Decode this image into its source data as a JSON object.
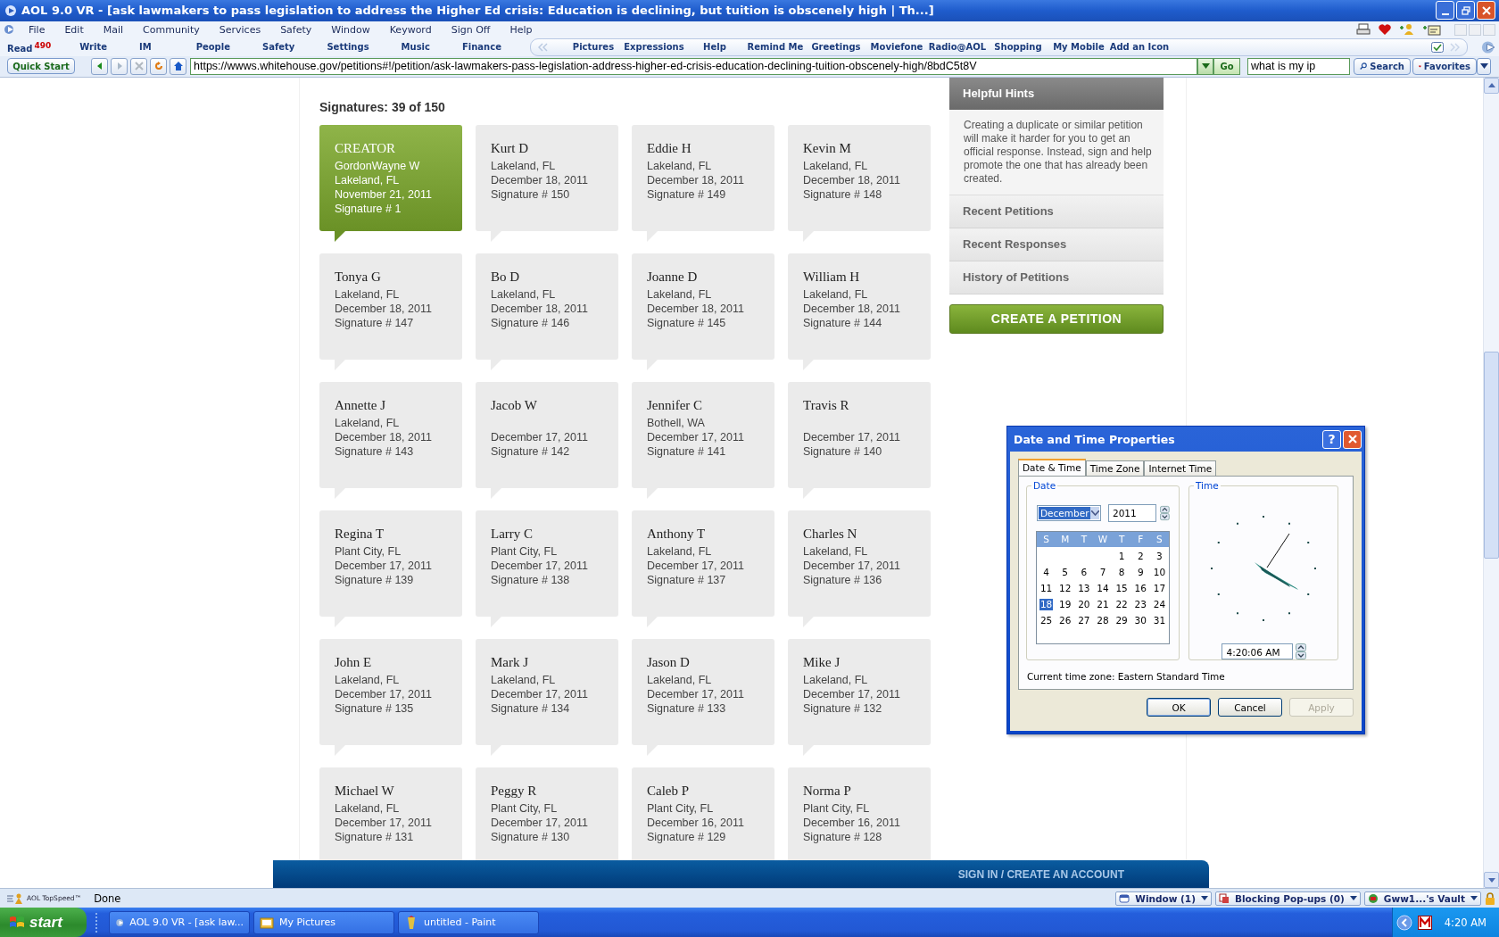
{
  "window": {
    "title": "AOL 9.0 VR - [ask lawmakers to pass legislation to address the Higher Ed crisis: Education is declining, but tuition is obscenely high | Th...]"
  },
  "menu": [
    "File",
    "Edit",
    "Mail",
    "Community",
    "Services",
    "Safety",
    "Window",
    "Keyword",
    "Sign Off",
    "Help"
  ],
  "toolbar": {
    "read": {
      "label": "Read",
      "badge": "490"
    },
    "items": [
      "Write",
      "IM",
      "People",
      "Safety",
      "Settings",
      "Music",
      "Finance"
    ],
    "favorites_strip": [
      "Pictures",
      "Expressions",
      "Help",
      "Remind Me",
      "Greetings",
      "Moviefone",
      "Radio@AOL",
      "Shopping",
      "My Mobile",
      "Add an Icon"
    ]
  },
  "address_bar": {
    "quick_start": "Quick Start",
    "url": "https://wwws.whitehouse.gov/petitions#!/petition/ask-lawmakers-pass-legislation-address-higher-ed-crisis-education-declining-tuition-obscenely-high/8bdC5t8V",
    "go": "Go",
    "search_value": "what is my ip",
    "search": "Search",
    "favorites": "Favorites"
  },
  "page": {
    "signatures_heading": "Signatures: 39 of 150",
    "cards": [
      {
        "kind": "creator",
        "label": "CREATOR",
        "name": "GordonWayne W",
        "location": "Lakeland, FL",
        "date": "November 21, 2011",
        "signature": "Signature # 1"
      },
      {
        "kind": "signer",
        "name": "Kurt D",
        "location": "Lakeland, FL",
        "date": "December 18, 2011",
        "signature": "Signature # 150"
      },
      {
        "kind": "signer",
        "name": "Eddie H",
        "location": "Lakeland, FL",
        "date": "December 18, 2011",
        "signature": "Signature # 149"
      },
      {
        "kind": "signer",
        "name": "Kevin M",
        "location": "Lakeland, FL",
        "date": "December 18, 2011",
        "signature": "Signature # 148"
      },
      {
        "kind": "signer",
        "name": "Tonya G",
        "location": "Lakeland, FL",
        "date": "December 18, 2011",
        "signature": "Signature # 147"
      },
      {
        "kind": "signer",
        "name": "Bo D",
        "location": "Lakeland, FL",
        "date": "December 18, 2011",
        "signature": "Signature # 146"
      },
      {
        "kind": "signer",
        "name": "Joanne D",
        "location": "Lakeland, FL",
        "date": "December 18, 2011",
        "signature": "Signature # 145"
      },
      {
        "kind": "signer",
        "name": "William H",
        "location": "Lakeland, FL",
        "date": "December 18, 2011",
        "signature": "Signature # 144"
      },
      {
        "kind": "signer",
        "name": "Annette J",
        "location": "Lakeland, FL",
        "date": "December 18, 2011",
        "signature": "Signature # 143"
      },
      {
        "kind": "signer",
        "name": "Jacob W",
        "date": "December 17, 2011",
        "signature": "Signature # 142"
      },
      {
        "kind": "signer",
        "name": "Jennifer C",
        "location": "Bothell, WA",
        "date": "December 17, 2011",
        "signature": "Signature # 141"
      },
      {
        "kind": "signer",
        "name": "Travis R",
        "date": "December 17, 2011",
        "signature": "Signature # 140"
      },
      {
        "kind": "signer",
        "name": "Regina T",
        "location": "Plant City, FL",
        "date": "December 17, 2011",
        "signature": "Signature # 139"
      },
      {
        "kind": "signer",
        "name": "Larry C",
        "location": "Plant City, FL",
        "date": "December 17, 2011",
        "signature": "Signature # 138"
      },
      {
        "kind": "signer",
        "name": "Anthony T",
        "location": "Lakeland, FL",
        "date": "December 17, 2011",
        "signature": "Signature # 137"
      },
      {
        "kind": "signer",
        "name": "Charles N",
        "location": "Lakeland, FL",
        "date": "December 17, 2011",
        "signature": "Signature # 136"
      },
      {
        "kind": "signer",
        "name": "John E",
        "location": "Lakeland, FL",
        "date": "December 17, 2011",
        "signature": "Signature # 135"
      },
      {
        "kind": "signer",
        "name": "Mark J",
        "location": "Lakeland, FL",
        "date": "December 17, 2011",
        "signature": "Signature # 134"
      },
      {
        "kind": "signer",
        "name": "Jason D",
        "location": "Lakeland, FL",
        "date": "December 17, 2011",
        "signature": "Signature # 133"
      },
      {
        "kind": "signer",
        "name": "Mike J",
        "location": "Lakeland, FL",
        "date": "December 17, 2011",
        "signature": "Signature # 132"
      },
      {
        "kind": "signer",
        "name": "Michael W",
        "location": "Lakeland, FL",
        "date": "December 17, 2011",
        "signature": "Signature # 131"
      },
      {
        "kind": "signer",
        "name": "Peggy R",
        "location": "Plant City, FL",
        "date": "December 17, 2011",
        "signature": "Signature # 130"
      },
      {
        "kind": "signer",
        "name": "Caleb P",
        "location": "Plant City, FL",
        "date": "December 16, 2011",
        "signature": "Signature # 129"
      },
      {
        "kind": "signer",
        "name": "Norma P",
        "location": "Plant City, FL",
        "date": "December 16, 2011",
        "signature": "Signature # 128"
      }
    ],
    "sidebar": {
      "hints_title": "Helpful Hints",
      "hints_text": "Creating a duplicate or similar petition will make it harder for you to get an official response. Instead, sign and help promote the one that has already been created.",
      "links": [
        "Recent Petitions",
        "Recent Responses",
        "History of Petitions"
      ],
      "create_button": "CREATE A PETITION"
    },
    "sign_in_bar": "SIGN IN / CREATE AN ACCOUNT"
  },
  "dialog": {
    "title": "Date and Time Properties",
    "help": "?",
    "tabs": [
      {
        "label": "Date & Time",
        "selected": true
      },
      {
        "label": "Time Zone",
        "selected": false
      },
      {
        "label": "Internet Time",
        "selected": false
      }
    ],
    "date_group": "Date",
    "month": "December",
    "year": "2011",
    "weekdays": [
      "S",
      "M",
      "T",
      "W",
      "T",
      "F",
      "S"
    ],
    "weeks": [
      [
        {
          "day": "1",
          "selected": false
        },
        {
          "day": "2",
          "selected": false
        },
        {
          "day": "3",
          "selected": false
        }
      ],
      [
        {
          "day": "4",
          "selected": false
        },
        {
          "day": "5",
          "selected": false
        },
        {
          "day": "6",
          "selected": false
        },
        {
          "day": "7",
          "selected": false
        },
        {
          "day": "8",
          "selected": false
        },
        {
          "day": "9",
          "selected": false
        },
        {
          "day": "10",
          "selected": false
        }
      ],
      [
        {
          "day": "11",
          "selected": false
        },
        {
          "day": "12",
          "selected": false
        },
        {
          "day": "13",
          "selected": false
        },
        {
          "day": "14",
          "selected": false
        },
        {
          "day": "15",
          "selected": false
        },
        {
          "day": "16",
          "selected": false
        },
        {
          "day": "17",
          "selected": false
        }
      ],
      [
        {
          "day": "18",
          "selected": true
        },
        {
          "day": "19",
          "selected": false
        },
        {
          "day": "20",
          "selected": false
        },
        {
          "day": "21",
          "selected": false
        },
        {
          "day": "22",
          "selected": false
        },
        {
          "day": "23",
          "selected": false
        },
        {
          "day": "24",
          "selected": false
        }
      ],
      [
        {
          "day": "25",
          "selected": false
        },
        {
          "day": "26",
          "selected": false
        },
        {
          "day": "27",
          "selected": false
        },
        {
          "day": "28",
          "selected": false
        },
        {
          "day": "29",
          "selected": false
        },
        {
          "day": "30",
          "selected": false
        },
        {
          "day": "31",
          "selected": false
        }
      ]
    ],
    "time_group": "Time",
    "time": "4:20:06 AM",
    "time_zone": "Current time zone:  Eastern Standard Time",
    "buttons": [
      {
        "label": "OK",
        "disabled": false
      },
      {
        "label": "Cancel",
        "disabled": false
      },
      {
        "label": "Apply",
        "disabled": true
      }
    ]
  },
  "status_bar": {
    "topspeed": "AOL TopSpeed™",
    "status": "Done",
    "window": "Window (1)",
    "popups": "Blocking Pop-ups (0)",
    "vault": "Gww1...'s Vault"
  },
  "taskbar": {
    "start": "start",
    "tasks": [
      {
        "label": "AOL 9.0 VR - [ask law...",
        "selected": false
      },
      {
        "label": "My Pictures",
        "selected": false
      },
      {
        "label": "untitled - Paint",
        "selected": false
      }
    ],
    "clock": "4:20 AM"
  }
}
